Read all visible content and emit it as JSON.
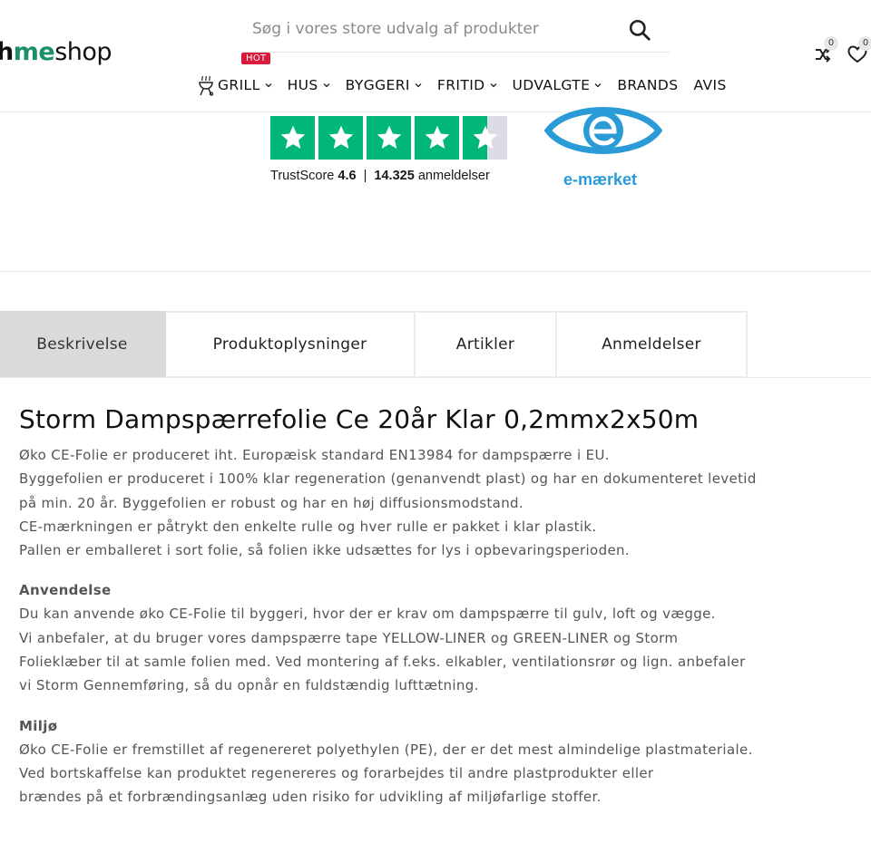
{
  "header": {
    "logo": {
      "part1": "h",
      "part2": "me",
      "part3": "shop"
    },
    "search": {
      "placeholder": "Søg i vores store udvalg af produkter"
    },
    "compare_count": "0",
    "wishlist_count": "0",
    "nav": {
      "hot_badge": "HOT",
      "items": [
        {
          "label": "GRILL",
          "dropdown": true
        },
        {
          "label": "HUS",
          "dropdown": true
        },
        {
          "label": "BYGGERI",
          "dropdown": true
        },
        {
          "label": "FRITID",
          "dropdown": true
        },
        {
          "label": "UDVALGTE",
          "dropdown": true
        },
        {
          "label": "BRANDS",
          "dropdown": false
        },
        {
          "label": "AVIS",
          "dropdown": false
        }
      ]
    }
  },
  "trust": {
    "stars_rating": 4.6,
    "trustscore_label": "TrustScore",
    "trustscore_value": "4.6",
    "separator": "|",
    "review_count": "14.325",
    "review_label": "anmeldelser",
    "emark_label": "e-mærket",
    "colors": {
      "trustpilot_green": "#00b67a",
      "emark_blue": "#2a9bd7"
    }
  },
  "tabs": [
    {
      "label": "Beskrivelse",
      "active": true
    },
    {
      "label": "Produktoplysninger",
      "active": false
    },
    {
      "label": "Artikler",
      "active": false
    },
    {
      "label": "Anmeldelser",
      "active": false
    }
  ],
  "product": {
    "title": "Storm Dampspærrefolie Ce 20år Klar 0,2mmx2x50m",
    "intro_lines": [
      "Øko CE-Folie er produceret iht. Europæisk standard EN13984 for dampspærre i EU.",
      "Byggefolien er produceret i 100% klar regeneration (genanvendt plast) og har en dokumenteret levetid",
      "på min. 20 år. Byggefolien er robust og har en høj diffusionsmodstand.",
      "CE-mærkningen er påtrykt den enkelte rulle og hver rulle er pakket i klar plastik.",
      "Pallen er emballeret i sort folie, så folien ikke udsættes for lys i opbevaringsperioden."
    ],
    "use_heading": "Anvendelse",
    "use_lines": [
      "Du kan anvende øko CE-Folie til byggeri, hvor der er krav om dampspærre til gulv, loft og vægge.",
      "Vi anbefaler, at du bruger vores dampspærre tape YELLOW-LINER og GREEN-LINER og Storm",
      "Folieklæber til at samle folien med. Ved montering af f.eks. elkabler, ventilationsrør og lign. anbefaler",
      "vi Storm Gennemføring, så du opnår en fuldstændig lufttætning."
    ],
    "env_heading": "Miljø",
    "env_lines": [
      "Øko CE-Folie er fremstillet af regenereret polyethylen (PE), der er det mest almindelige plastmateriale.",
      "Ved bortskaffelse kan produktet regenereres og forarbejdes til andre plastprodukter eller",
      "brændes på et forbrændingsanlæg uden risiko for udvikling af miljøfarlige stoffer."
    ]
  }
}
